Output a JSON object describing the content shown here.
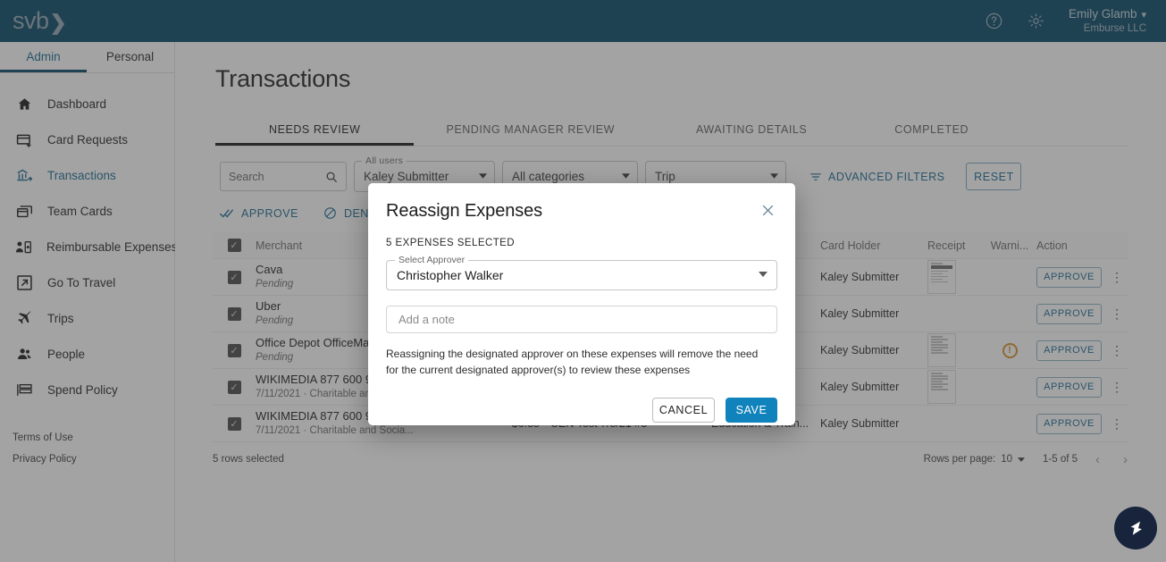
{
  "brand": {
    "logo_text": "svb",
    "logo_chevron": "❯",
    "primary": "#064868",
    "accent": "#1a6a92",
    "save_blue": "#1083bc",
    "warn": "#d9912a"
  },
  "header": {
    "help_icon": "help-circle-icon",
    "settings_icon": "gear-icon",
    "user_name": "Emily Glamb",
    "user_caret": "⌄",
    "user_org": "Emburse LLC"
  },
  "sidebar": {
    "subtabs": [
      {
        "label": "Admin",
        "active": true
      },
      {
        "label": "Personal",
        "active": false
      }
    ],
    "items": [
      {
        "label": "Dashboard",
        "icon": "home-icon",
        "active": false
      },
      {
        "label": "Card Requests",
        "icon": "card-plus-icon",
        "active": false
      },
      {
        "label": "Transactions",
        "icon": "bank-transfer-icon",
        "active": true
      },
      {
        "label": "Team Cards",
        "icon": "cards-stack-icon",
        "active": false
      },
      {
        "label": "Reimbursable Expenses",
        "icon": "person-receipt-icon",
        "active": false
      },
      {
        "label": "Go To Travel",
        "icon": "external-link-icon",
        "active": false
      },
      {
        "label": "Trips",
        "icon": "airplane-icon",
        "active": false
      },
      {
        "label": "People",
        "icon": "people-icon",
        "active": false
      },
      {
        "label": "Spend Policy",
        "icon": "policy-list-icon",
        "active": false
      }
    ],
    "legal": [
      "Terms of Use",
      "Privacy Policy"
    ]
  },
  "main": {
    "page_title": "Transactions",
    "tabs": [
      {
        "label": "NEEDS REVIEW",
        "active": true
      },
      {
        "label": "PENDING MANAGER REVIEW",
        "active": false
      },
      {
        "label": "AWAITING DETAILS",
        "active": false
      },
      {
        "label": "COMPLETED",
        "active": false
      }
    ],
    "filters": {
      "search_placeholder": "Search",
      "search_value": "",
      "search_icon": "search-icon",
      "user_select": {
        "label": "All users",
        "value": "Kaley Submitter"
      },
      "category_select": {
        "label": "",
        "value": "All categories"
      },
      "trip_select": {
        "label": "",
        "value": "Trip"
      },
      "advanced_filters_label": "ADVANCED FILTERS",
      "advanced_filters_icon": "filter-icon",
      "reset_label": "RESET"
    },
    "bulk_actions": [
      {
        "label": "APPROVE",
        "icon": "double-check-icon"
      },
      {
        "label": "DENY",
        "icon": "circle-slash-icon"
      }
    ],
    "table": {
      "columns": [
        "Merchant",
        "",
        "",
        "",
        "Card Holder",
        "Receipt",
        "Warni...",
        "Action"
      ],
      "header_checkbox_checked": true,
      "rows": [
        {
          "checked": true,
          "merchant": "Cava",
          "sub": "Pending",
          "sub_italic": true,
          "amount": "",
          "description": "",
          "category": "",
          "card_holder": "Kaley Submitter",
          "receipt": true,
          "warning": false,
          "action": "APPROVE",
          "menu_icon": "kebab-menu-icon"
        },
        {
          "checked": true,
          "merchant": "Uber",
          "sub": "Pending",
          "sub_italic": true,
          "amount": "",
          "description": "",
          "category": "",
          "card_holder": "Kaley Submitter",
          "receipt": false,
          "warning": false,
          "action": "APPROVE",
          "menu_icon": "kebab-menu-icon"
        },
        {
          "checked": true,
          "merchant": "Office Depot OfficeMax",
          "sub": "Pending",
          "sub_italic": true,
          "amount": "",
          "description": "",
          "category": "",
          "card_holder": "Kaley Submitter",
          "receipt": true,
          "warning": true,
          "action": "APPROVE",
          "menu_icon": "kebab-menu-icon"
        },
        {
          "checked": true,
          "merchant": "WIKIMEDIA 877 600 9454",
          "sub": "7/11/2021 · Charitable and Socia...",
          "sub_italic": false,
          "amount": "",
          "description": "",
          "category": "",
          "card_holder": "Kaley Submitter",
          "receipt": true,
          "warning": false,
          "action": "APPROVE",
          "menu_icon": "kebab-menu-icon"
        },
        {
          "checked": true,
          "merchant": "WIKIMEDIA 877 600 9454",
          "sub": "7/11/2021 · Charitable and Socia...",
          "sub_italic": false,
          "amount": "$6.35",
          "description": "CEN Test 7/8/21 #3",
          "category": "Education & Train...",
          "card_holder": "Kaley Submitter",
          "receipt": false,
          "warning": false,
          "action": "APPROVE",
          "menu_icon": "kebab-menu-icon"
        }
      ]
    },
    "footer": {
      "rows_selected": "5 rows selected",
      "rows_per_page_label": "Rows per page:",
      "rows_per_page_value": "10",
      "range": "1-5 of 5",
      "prev_icon": "chevron-left-icon",
      "next_icon": "chevron-right-icon"
    },
    "fab_icon": "chat-launcher-icon"
  },
  "modal": {
    "title": "Reassign Expenses",
    "close_icon": "close-icon",
    "selected_count": "5 EXPENSES SELECTED",
    "approver_field": {
      "label": "Select Approver",
      "value": "Christopher Walker",
      "caret_icon": "chevron-down-icon"
    },
    "note_field": {
      "placeholder": "Add a note",
      "value": ""
    },
    "description": "Reassigning the designated approver on these expenses will remove the need for the current designated approver(s) to review these expenses",
    "cancel_label": "CANCEL",
    "save_label": "SAVE"
  }
}
